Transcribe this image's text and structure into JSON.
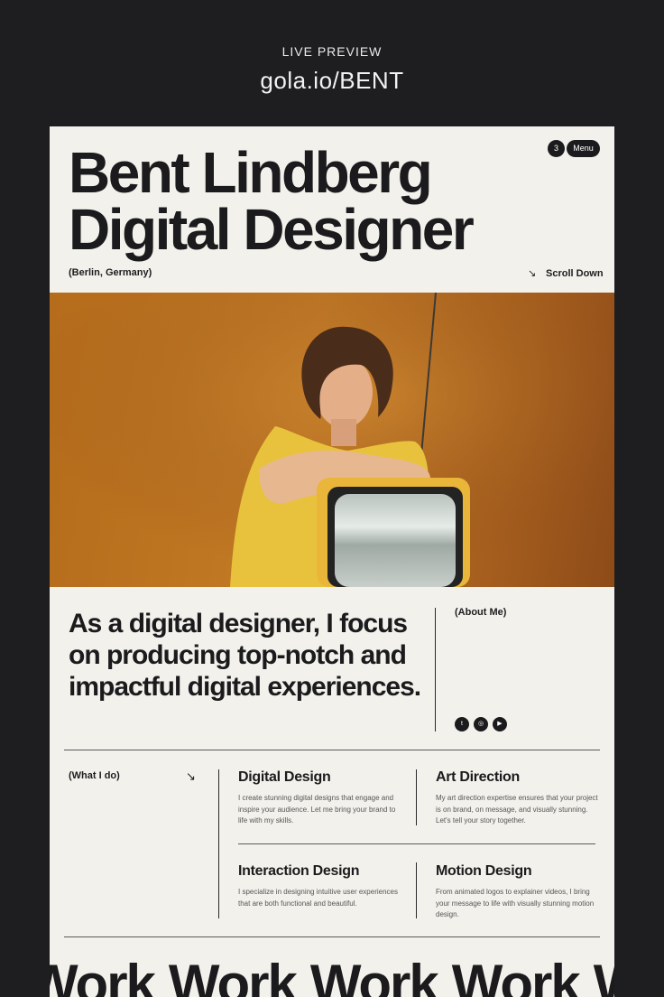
{
  "preview": {
    "label": "LIVE PREVIEW",
    "url": "gola.io/BENT"
  },
  "header": {
    "title_line1": "Bent Lindberg",
    "title_line2": "Digital Designer",
    "location": "(Berlin, Germany)",
    "scroll_label": "Scroll Down",
    "nav_count": "3",
    "menu_label": "Menu"
  },
  "intro": {
    "statement": "As a digital designer, I focus on producing top-notch and impactful digital experiences.",
    "about_label": "(About Me)",
    "social_icons": [
      "twitter-icon",
      "instagram-icon",
      "youtube-icon"
    ]
  },
  "services": {
    "section_label": "(What I do)",
    "items": [
      {
        "title": "Digital Design",
        "description": "I create stunning digital designs that engage and inspire your audience. Let me bring your brand to life with my skills."
      },
      {
        "title": "Art Direction",
        "description": "My art direction expertise ensures that your project is on brand, on message, and visually stunning. Let's tell your story together."
      },
      {
        "title": "Interaction Design",
        "description": "I specialize in designing intuitive user experiences that are both functional and beautiful."
      },
      {
        "title": "Motion Design",
        "description": "From animated logos to explainer videos, I bring your message to life with visually stunning motion design."
      }
    ]
  },
  "marquee": {
    "words": [
      "Work",
      "Work",
      "Work",
      "Work",
      "Work"
    ]
  },
  "colors": {
    "page_bg": "#1e1e21",
    "card_bg": "#f3f1ec",
    "text": "#1b1b1d",
    "photo_orange": "#c27a25"
  }
}
